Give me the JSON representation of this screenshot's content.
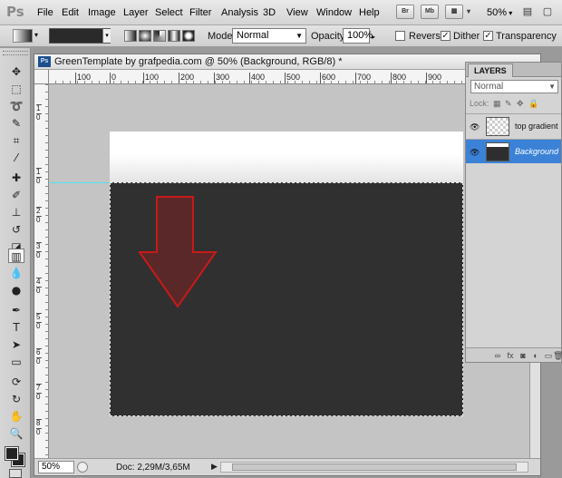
{
  "app": {
    "logo": "Ps",
    "menu": [
      "File",
      "Edit",
      "Image",
      "Layer",
      "Select",
      "Filter",
      "Analysis",
      "3D",
      "View",
      "Window",
      "Help"
    ],
    "app_buttons": [
      "Br",
      "Mb"
    ],
    "zoom": "50%"
  },
  "options_bar": {
    "mode_label": "Mode:",
    "mode_value": "Normal",
    "opacity_label": "Opacity:",
    "opacity_value": "100%",
    "reverse_label": "Reverse",
    "reverse_checked": false,
    "dither_label": "Dither",
    "dither_checked": true,
    "transparency_label": "Transparency",
    "transparency_checked": true
  },
  "document": {
    "title": "GreenTemplate by grafpedia.com @ 50% (Background, RGB/8) *",
    "badge": "Ps",
    "ruler_top": [
      "100",
      "0",
      "100",
      "200",
      "300",
      "400",
      "500",
      "600",
      "700",
      "800",
      "900"
    ],
    "ruler_left": [
      "1",
      "0",
      "1",
      "1",
      "0",
      "2",
      "0",
      "3",
      "0",
      "4",
      "0",
      "5",
      "0",
      "6",
      "0",
      "7",
      "0",
      "8",
      "0",
      "9",
      "0"
    ],
    "zoom_field": "50%",
    "doc_info": "Doc: 2,29M/3,65M",
    "colors": {
      "canvas_dark": "#303030",
      "arrow_fill": "#5a2a2a",
      "arrow_stroke": "#c81a1a",
      "guide": "#4fe3ef"
    }
  },
  "layers_panel": {
    "tab": "LAYERS",
    "blend_mode": "Normal",
    "lock_label": "Lock:",
    "layers": [
      {
        "name": "top gradient",
        "selected": false
      },
      {
        "name": "Background",
        "selected": true
      }
    ],
    "selection_color": "#3b82d6"
  }
}
